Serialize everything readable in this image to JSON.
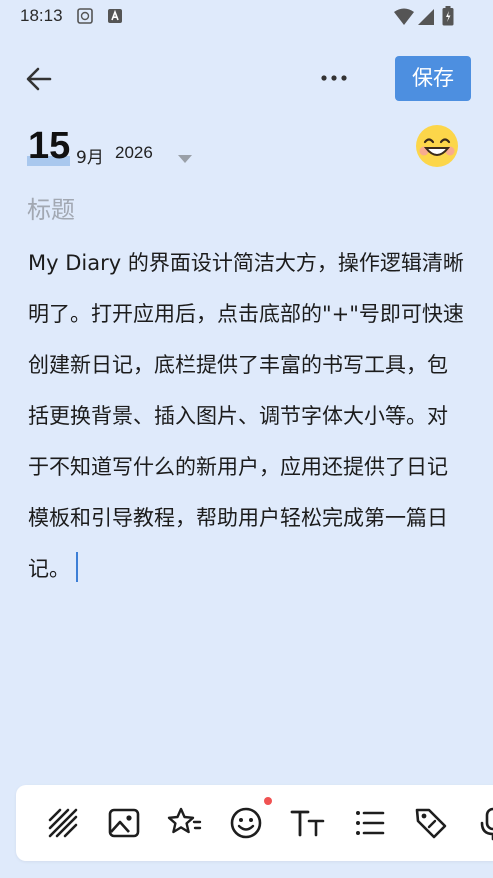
{
  "status_bar": {
    "time": "18:13",
    "icons": [
      "shield-icon",
      "a-badge-icon",
      "wifi-icon",
      "signal-icon",
      "battery-icon"
    ]
  },
  "header": {
    "back_icon": "arrow-left-icon",
    "more_icon": "more-dots-icon",
    "save_label": "保存"
  },
  "date": {
    "day": "15",
    "month": "9月",
    "year": "2026"
  },
  "mood": {
    "icon": "smiling-face-emoji"
  },
  "editor": {
    "title_placeholder": "标题",
    "body": "My Diary 的界面设计简洁大方，操作逻辑清晰明了。打开应用后，点击底部的\"+\"号即可快速创建新日记，底栏提供了丰富的书写工具，包括更换背景、插入图片、调节字体大小等。对于不知道写什么的新用户，应用还提供了日记模板和引导教程，帮助用户轻松完成第一篇日记。"
  },
  "toolbar": {
    "items": [
      "background-pattern-icon",
      "image-icon",
      "star-template-icon",
      "emoji-icon",
      "text-size-icon",
      "list-icon",
      "tag-icon",
      "microphone-icon"
    ]
  },
  "colors": {
    "background": "#dfeafb",
    "accent": "#4d8fe0",
    "notification_dot": "#f05252"
  }
}
